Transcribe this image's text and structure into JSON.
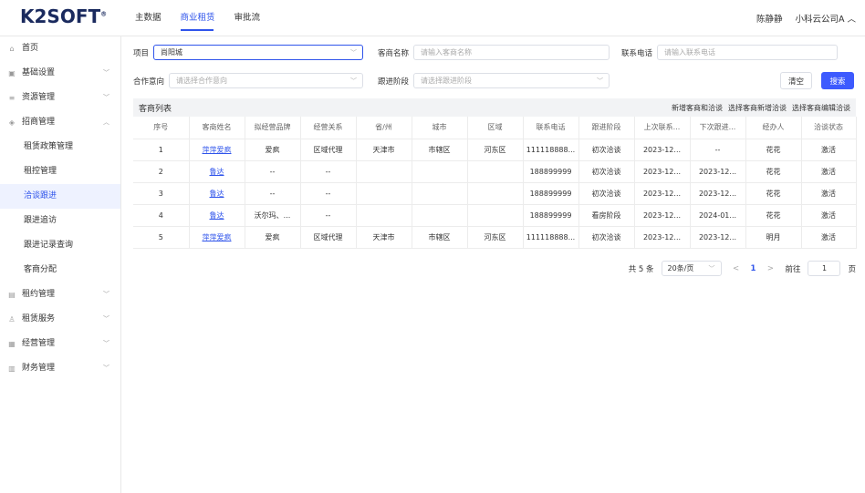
{
  "app": {
    "logo": "K2SOFT",
    "logo_mark": "®"
  },
  "topnav": [
    "主数据",
    "商业租赁",
    "审批流"
  ],
  "user": {
    "name": "陈静静",
    "company": "小科云公司A"
  },
  "sidebar": [
    {
      "label": "首页",
      "icon": "home-icon",
      "chevron": false,
      "sub": false
    },
    {
      "label": "基础设置",
      "icon": "settings-icon",
      "chevron": "down",
      "sub": false
    },
    {
      "label": "资源管理",
      "icon": "resource-icon",
      "chevron": "down",
      "sub": false
    },
    {
      "label": "招商管理",
      "icon": "merchant-icon",
      "chevron": "up",
      "sub": false
    },
    {
      "label": "租赁政策管理",
      "sub": true
    },
    {
      "label": "租控管理",
      "sub": true
    },
    {
      "label": "洽谈跟进",
      "sub": true,
      "active": true
    },
    {
      "label": "跟进追访",
      "sub": true
    },
    {
      "label": "跟进记录查询",
      "sub": true
    },
    {
      "label": "客商分配",
      "sub": true
    },
    {
      "label": "租约管理",
      "icon": "contract-icon",
      "chevron": "down",
      "sub": false
    },
    {
      "label": "租赁服务",
      "icon": "service-icon",
      "chevron": "down",
      "sub": false
    },
    {
      "label": "经营管理",
      "icon": "operation-icon",
      "chevron": "down",
      "sub": false
    },
    {
      "label": "财务管理",
      "icon": "finance-icon",
      "chevron": "down",
      "sub": false
    }
  ],
  "filters": {
    "project_label": "项目",
    "project_value": "尚阳城",
    "name_label": "客商名称",
    "name_placeholder": "请输入客商名称",
    "phone_label": "联系电话",
    "phone_placeholder": "请输入联系电话",
    "intent_label": "合作意向",
    "intent_placeholder": "请选择合作意向",
    "stage_label": "跟进阶段",
    "stage_placeholder": "请选择跟进阶段",
    "clear_label": "清空",
    "search_label": "搜索"
  },
  "list": {
    "title": "客商列表",
    "actions": [
      "新增客商和洽谈",
      "选择客商新增洽谈",
      "选择客商编辑洽谈"
    ],
    "columns": [
      "序号",
      "客商姓名",
      "拟经营品牌",
      "经营关系",
      "省/州",
      "城市",
      "区域",
      "联系电话",
      "跟进阶段",
      "上次联系...",
      "下次跟进...",
      "经办人",
      "洽谈状态"
    ],
    "rows": [
      [
        "1",
        "萍萍爱疯",
        "爱疯",
        "区域代理",
        "天津市",
        "市辖区",
        "河东区",
        "111118888...",
        "初次洽谈",
        "2023-12...",
        "--",
        "花花",
        "激活"
      ],
      [
        "2",
        "鲁达",
        "--",
        "--",
        "",
        "",
        "",
        "188899999",
        "初次洽谈",
        "2023-12...",
        "2023-12...",
        "花花",
        "激活"
      ],
      [
        "3",
        "鲁达",
        "--",
        "--",
        "",
        "",
        "",
        "188899999",
        "初次洽谈",
        "2023-12...",
        "2023-12...",
        "花花",
        "激活"
      ],
      [
        "4",
        "鲁达",
        "沃尔玛、...",
        "--",
        "",
        "",
        "",
        "188899999",
        "看房阶段",
        "2023-12...",
        "2024-01...",
        "花花",
        "激活"
      ],
      [
        "5",
        "萍萍爱疯",
        "爱疯",
        "区域代理",
        "天津市",
        "市辖区",
        "河东区",
        "111118888...",
        "初次洽谈",
        "2023-12...",
        "2023-12...",
        "明月",
        "激活"
      ]
    ]
  },
  "pager": {
    "total": "共 5 条",
    "size": "20条/页",
    "current": "1",
    "goto_label": "前往",
    "goto_value": "1",
    "page_unit": "页"
  }
}
